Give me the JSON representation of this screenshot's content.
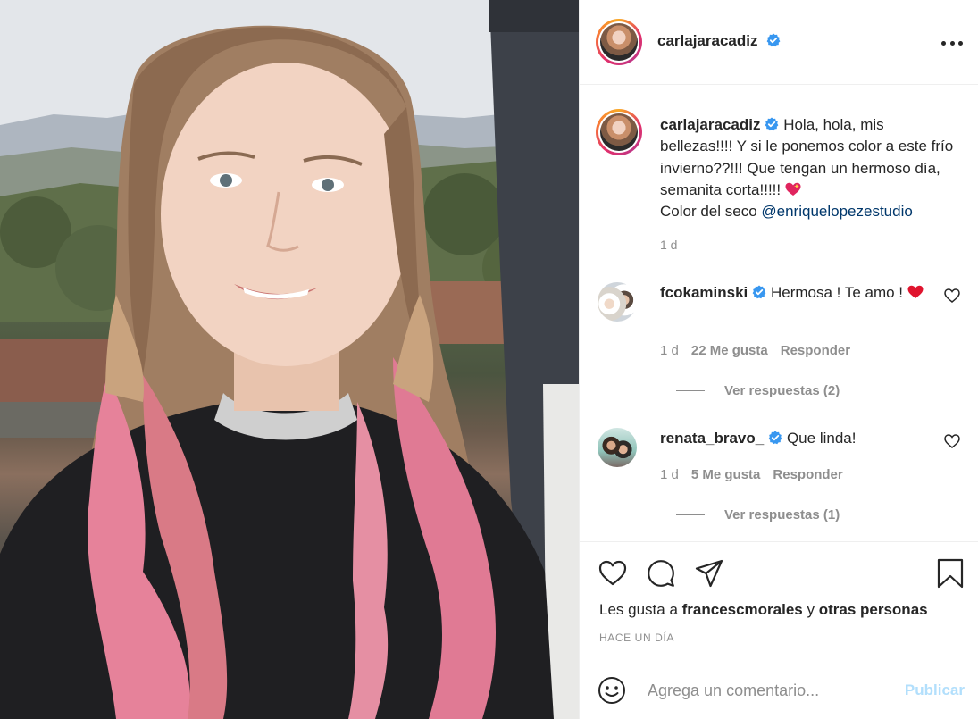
{
  "post": {
    "image_alt": "Mujer sonriente con cabello castaño y puntas rosas, suéter negro, frente a un paisaje de montañas"
  },
  "header": {
    "username": "carlajaracadiz",
    "more_icon": "more-horizontal-icon"
  },
  "caption": {
    "username": "carlajaracadiz",
    "text_before": " Hola, hola, mis bellezas!!!! Y si le ponemos color a este frío invierno??!!! Que tengan un hermoso día, semanita corta!!!!! ",
    "text_line2": " Color del seco ",
    "mention": "@enriquelopezestudio",
    "time": "1 d"
  },
  "comments": [
    {
      "username": "fcokaminski",
      "text": " Hermosa ! Te amo ! ",
      "time": "1 d",
      "likes": "22 Me gusta",
      "reply": "Responder",
      "view_replies": "Ver respuestas (2)"
    },
    {
      "username": "renata_bravo_",
      "text": " Que linda!",
      "time": "1 d",
      "likes": "5 Me gusta",
      "reply": "Responder",
      "view_replies": "Ver respuestas (1)"
    }
  ],
  "actions": {
    "like_icon": "heart-icon",
    "comment_icon": "comment-icon",
    "share_icon": "send-icon",
    "save_icon": "bookmark-icon"
  },
  "likes": {
    "prefix": "Les gusta a ",
    "first_user": "francescmorales",
    "middle": " y ",
    "others": "otras personas"
  },
  "time_ago": "HACE UN DÍA",
  "comment_box": {
    "placeholder": "Agrega un comentario...",
    "publish_label": "Publicar"
  },
  "colors": {
    "verified": "#3897f0",
    "mention": "#00376b",
    "publish_disabled": "#b2dffc",
    "muted": "#8e8e8e"
  }
}
